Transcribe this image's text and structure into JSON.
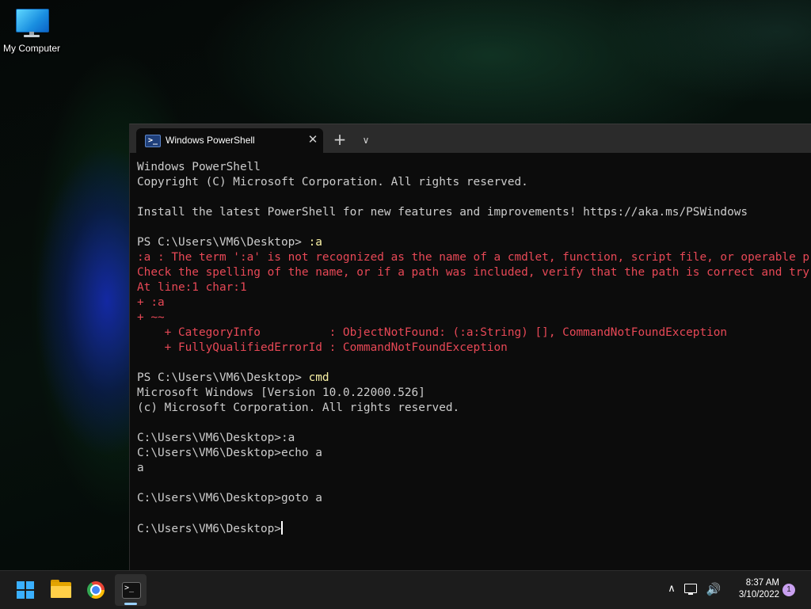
{
  "desktop": {
    "icons": [
      {
        "label": "My Computer",
        "icon": "monitor-icon"
      }
    ]
  },
  "terminal": {
    "tab": {
      "title": "Windows PowerShell",
      "icon": "powershell-icon",
      "close_glyph": "✕"
    },
    "new_tab_glyph": "+",
    "dropdown_glyph": "∨",
    "lines": [
      "Windows PowerShell",
      "Copyright (C) Microsoft Corporation. All rights reserved.",
      "",
      "Install the latest PowerShell for new features and improvements! https://aka.ms/PSWindows",
      "",
      "PS C:\\Users\\VM6\\Desktop> ",
      ":a : The term ':a' is not recognized as the name of a cmdlet, function, script file, or operable program.",
      "Check the spelling of the name, or if a path was included, verify that the path is correct and try again.",
      "At line:1 char:1",
      "+ :a",
      "+ ~~",
      "    + CategoryInfo          : ObjectNotFound: (:a:String) [], CommandNotFoundException",
      "    + FullyQualifiedErrorId : CommandNotFoundException",
      "",
      "PS C:\\Users\\VM6\\Desktop> ",
      "Microsoft Windows [Version 10.0.22000.526]",
      "(c) Microsoft Corporation. All rights reserved.",
      "",
      "C:\\Users\\VM6\\Desktop>:a",
      "C:\\Users\\VM6\\Desktop>echo a",
      "a",
      "",
      "C:\\Users\\VM6\\Desktop>goto a",
      "",
      "C:\\Users\\VM6\\Desktop>"
    ],
    "commands": {
      "first": ":a",
      "second": "cmd"
    }
  },
  "taskbar": {
    "apps": [
      {
        "name": "Start",
        "icon": "windows-start-icon"
      },
      {
        "name": "File Explorer",
        "icon": "folder-icon"
      },
      {
        "name": "Google Chrome",
        "icon": "chrome-icon"
      },
      {
        "name": "Windows Terminal",
        "icon": "terminal-icon",
        "active": true
      }
    ],
    "tray": {
      "chevron_glyph": "∧",
      "volume_glyph": "🔊",
      "time": "8:37 AM",
      "date": "3/10/2022",
      "notification_count": "1"
    }
  },
  "colors": {
    "error": "#e74856",
    "command": "#f9f1a5",
    "text": "#cccccc",
    "console_bg": "#0c0c0c",
    "titlebar_bg": "#2b2b2b",
    "taskbar_bg": "#1c1c1c"
  }
}
